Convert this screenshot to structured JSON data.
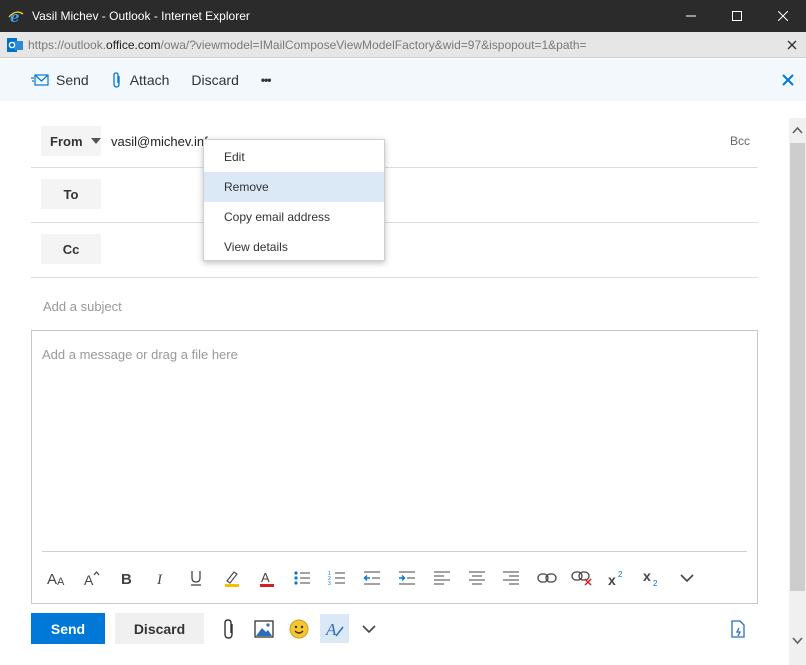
{
  "window": {
    "title": "Vasil Michev - Outlook - Internet Explorer"
  },
  "address": {
    "url_prefix": "https://outlook.",
    "url_domain": "office.com",
    "url_rest": "/owa/?viewmodel=IMailComposeViewModelFactory&wid=97&ispopout=1&path="
  },
  "toolbar": {
    "send_label": "Send",
    "attach_label": "Attach",
    "discard_label": "Discard",
    "more_label": "•••"
  },
  "compose": {
    "from_label": "From",
    "from_value": "vasil@michev.info",
    "to_label": "To",
    "cc_label": "Cc",
    "bcc_label": "Bcc",
    "subject_placeholder": "Add a subject",
    "message_placeholder": "Add a message or drag a file here"
  },
  "context_menu": {
    "items": [
      "Edit",
      "Remove",
      "Copy email address",
      "View details"
    ],
    "highlighted": "Remove"
  },
  "bottom": {
    "send_label": "Send",
    "discard_label": "Discard"
  },
  "formatting_icons": [
    "font-size-icon",
    "grow-font-icon",
    "bold-icon",
    "italic-icon",
    "underline-icon",
    "highlight-icon",
    "font-color-icon",
    "bullets-icon",
    "numbering-icon",
    "decrease-indent-icon",
    "increase-indent-icon",
    "align-left-icon",
    "align-center-icon",
    "align-right-icon",
    "insert-link-icon",
    "remove-link-icon",
    "superscript-icon",
    "subscript-icon",
    "more-options-icon"
  ],
  "colors": {
    "accent": "#0078d7",
    "titlebar": "#2b2b2b",
    "toolbar_bg": "#f3f8fd",
    "menu_hover": "#dbe9f7"
  }
}
